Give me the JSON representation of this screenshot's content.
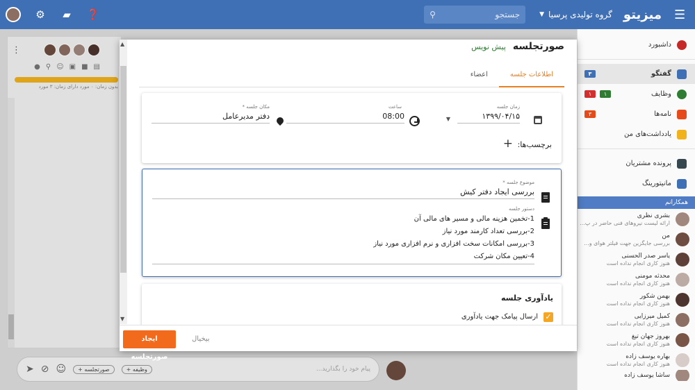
{
  "topbar": {
    "brand": "میزیتو",
    "org": "گروه تولیدی پرسیا",
    "search_placeholder": "جستجو"
  },
  "sidebar": {
    "items": [
      {
        "label": "داشبورد",
        "icon": "dashboard-icon",
        "color": "#c62828"
      },
      {
        "label": "گفتگو",
        "icon": "chat-icon",
        "color": "#3f6fb5",
        "badges": [
          "۳"
        ]
      },
      {
        "label": "وظایف",
        "icon": "task-icon",
        "color": "#2e7d32",
        "badges": [
          "۱",
          "۱"
        ]
      },
      {
        "label": "نامه‌ها",
        "icon": "mail-icon",
        "color": "#e64a19",
        "badges": [
          "۳"
        ]
      },
      {
        "label": "یادداشت‌های من",
        "icon": "note-icon",
        "color": "#f2b21c"
      },
      {
        "label": "پرونده مشتریان",
        "icon": "customer-icon",
        "color": "#37474f"
      },
      {
        "label": "مانیتورینگ",
        "icon": "monitoring-icon",
        "color": "#3f6fb5"
      }
    ],
    "section_title": "همکارانم",
    "colleagues": [
      {
        "name": "بشری نظری",
        "status": "ارائه لیست نیروهای فنی حاضر در پ..."
      },
      {
        "name": "من",
        "status": "بررسی جایگزین جهت فیلتر هوای و..."
      },
      {
        "name": "یاسر صدر الحسنی",
        "status": "هنوز کاری انجام نداده است"
      },
      {
        "name": "محدثه مومنی",
        "status": "هنوز کاری انجام نداده است"
      },
      {
        "name": "بهمن شکور",
        "status": "هنوز کاری انجام نداده است"
      },
      {
        "name": "کمیل میرزایی",
        "status": "هنوز کاری انجام نداده است"
      },
      {
        "name": "بهروز جهان تیغ",
        "status": "هنوز کاری انجام نداده است"
      },
      {
        "name": "بهاره یوسف زاده",
        "status": "هنوز کاری انجام نداده است"
      },
      {
        "name": "ساشا یوسف زاده",
        "status": ""
      }
    ]
  },
  "chat": {
    "meta": "بدون زمان: ۰ مورد   دارای زمان: ۳ مورد",
    "composer_placeholder": "پیام خود را بگذارید...",
    "pill_task": "+ وظیفه",
    "pill_minutes": "+ صورتجلسه"
  },
  "modal": {
    "title": "صورتجلسه",
    "subtitle": "پیش نویس",
    "tabs": [
      "اطلاعات جلسه",
      "اعضاء"
    ],
    "meeting_time_label": "زمان جلسه",
    "meeting_time_value": "۱۳۹۹/۰۴/۱۵",
    "hour_label": "ساعت",
    "hour_value": "08:00",
    "place_label": "مکان جلسه *",
    "place_value": "دفتر مدیرعامل",
    "tags_label": "برچسب‌ها:",
    "subject_label": "موضوع جلسه *",
    "subject_value": "بررسی ایجاد دفتر کیش",
    "agenda_label": "دستور جلسه",
    "agenda_lines": [
      "1-تخمین هزینه مالی و مسیر های مالی آن",
      "2-بررسی تعداد کارمند مورد نیاز",
      "3-بررسی امکانات سخت افزاری و نرم افزاری مورد نیاز",
      "4-تعیین مکان شرکت"
    ],
    "reminder_title": "یادآوری جلسه",
    "reminder_sms": "ارسال پیامک جهت یادآوری",
    "submit": "ایجاد صورتجلسه",
    "cancel": "بیخیال"
  }
}
